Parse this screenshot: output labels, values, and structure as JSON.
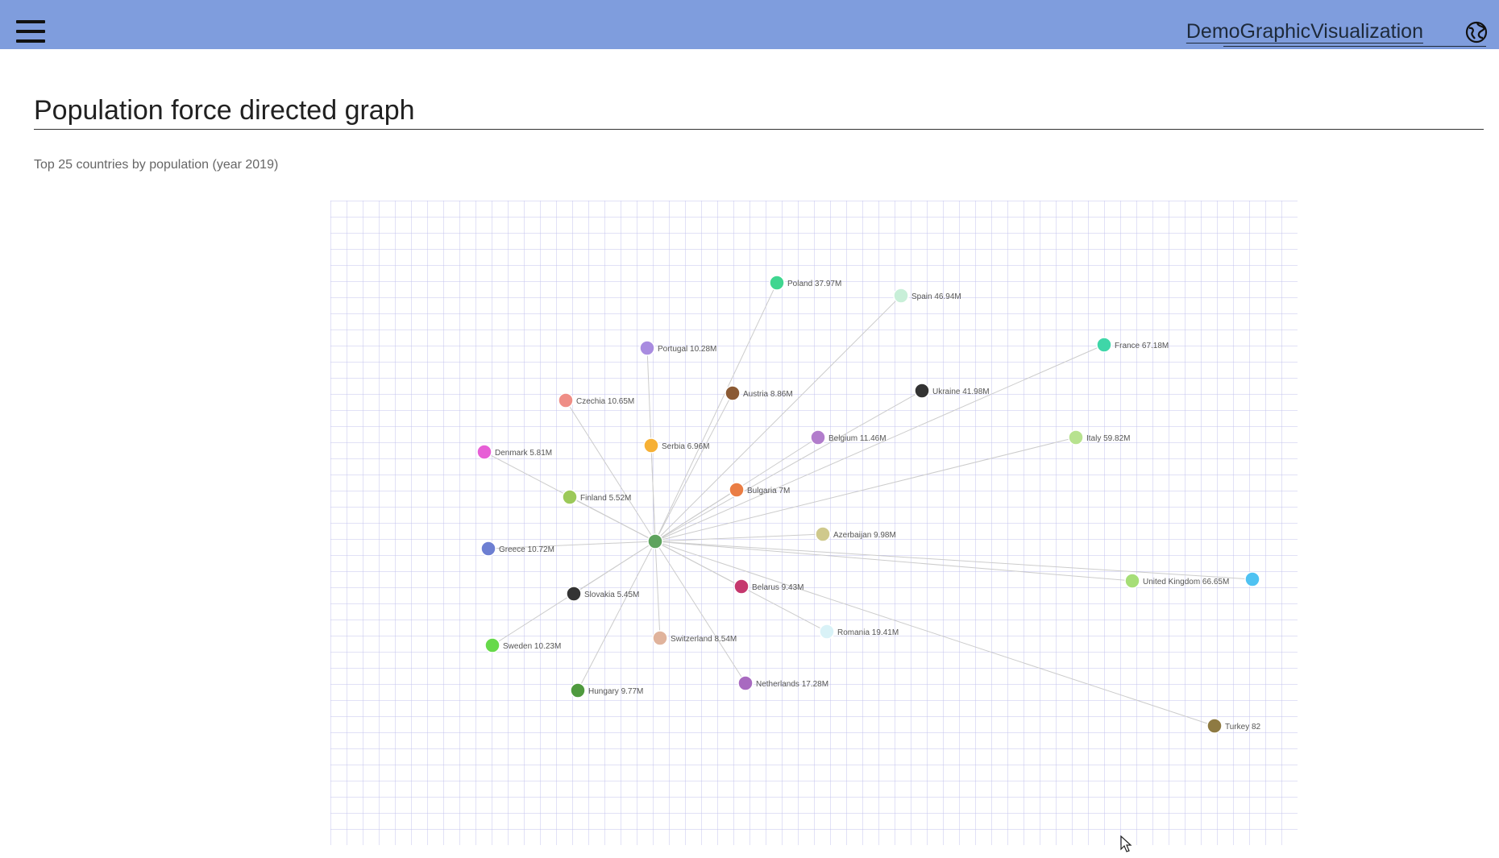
{
  "app": {
    "title": "DemoGraphicVisualization"
  },
  "page": {
    "title": "Population force directed graph",
    "subtitle": "Top 25 countries by population (year 2019)"
  },
  "icons": {
    "menu": "hamburger-menu-icon",
    "language": "globe-icon",
    "cursor": "mouse-pointer-icon"
  },
  "colors": {
    "header": "#7f9ddd",
    "grid": "#c3c3ee",
    "link": "#cccccc"
  },
  "chart_data": {
    "type": "force-directed-graph",
    "grid": true,
    "hub": {
      "color": "#5ea35e"
    },
    "nodes": [
      {
        "label": "Poland 37.97M",
        "color": "#3fd690"
      },
      {
        "label": "Spain 46.94M",
        "color": "#c8efd8"
      },
      {
        "label": "Portugal 10.28M",
        "color": "#a98ce0"
      },
      {
        "label": "France 67.18M",
        "color": "#3fd6a8"
      },
      {
        "label": "Czechia 10.65M",
        "color": "#ef8e86"
      },
      {
        "label": "Austria 8.86M",
        "color": "#8b5a34"
      },
      {
        "label": "Ukraine 41.98M",
        "color": "#333333"
      },
      {
        "label": "Denmark 5.81M",
        "color": "#e75fd6"
      },
      {
        "label": "Serbia 6.96M",
        "color": "#f6b035"
      },
      {
        "label": "Belgium 11.46M",
        "color": "#b27dcc"
      },
      {
        "label": "Italy 59.82M",
        "color": "#b7e28f"
      },
      {
        "label": "Finland 5.52M",
        "color": "#9cc95a"
      },
      {
        "label": "Bulgaria 7M",
        "color": "#ea7d44"
      },
      {
        "label": "Azerbaijan 9.98M",
        "color": "#cfc98c"
      },
      {
        "label": "Greece 10.72M",
        "color": "#6d7fd2"
      },
      {
        "label": "United Kingdom 66.65M",
        "color": "#a6de77"
      },
      {
        "label": "",
        "color": "#4fc2f2"
      },
      {
        "label": "Slovakia 5.45M",
        "color": "#333333"
      },
      {
        "label": "Belarus 9.43M",
        "color": "#c5386e"
      },
      {
        "label": "Switzerland 8.54M",
        "color": "#e0b39c"
      },
      {
        "label": "Romania 19.41M",
        "color": "#d9f2f7"
      },
      {
        "label": "Sweden 10.23M",
        "color": "#66d94a"
      },
      {
        "label": "Hungary 9.77M",
        "color": "#4f9a3f"
      },
      {
        "label": "Netherlands 17.28M",
        "color": "#a86ac0"
      },
      {
        "label": "Turkey 82",
        "color": "#8e7a42"
      }
    ]
  }
}
